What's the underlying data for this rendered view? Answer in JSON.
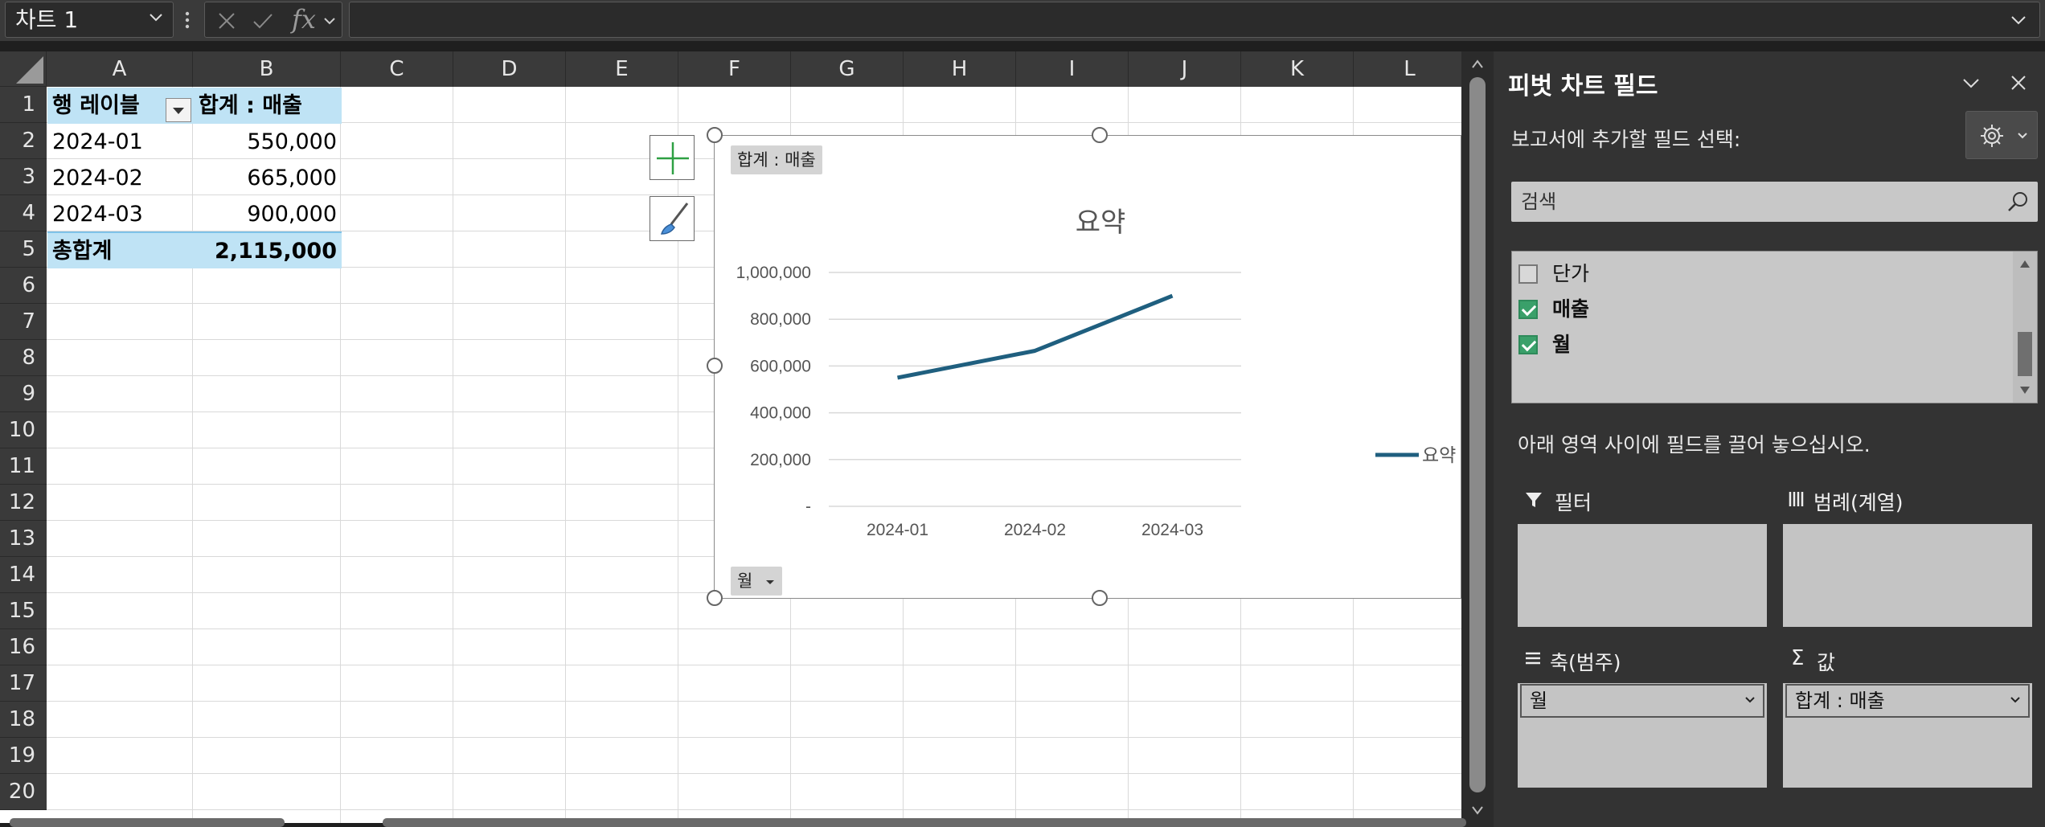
{
  "formula_bar": {
    "name_box": "차트 1",
    "fx": "fx",
    "formula": ""
  },
  "grid": {
    "columns": [
      "A",
      "B",
      "C",
      "D",
      "E",
      "F",
      "G",
      "H",
      "I",
      "J",
      "K",
      "L"
    ],
    "rows": [
      "1",
      "2",
      "3",
      "4",
      "5",
      "6",
      "7",
      "8",
      "9",
      "10",
      "11",
      "12",
      "13",
      "14",
      "15",
      "16",
      "17",
      "18",
      "19",
      "20"
    ],
    "pivot": {
      "header_row_label": "행 레이블",
      "header_value": "합계 : 매출",
      "rows": [
        {
          "label": "2024-01",
          "value": "550,000"
        },
        {
          "label": "2024-02",
          "value": "665,000"
        },
        {
          "label": "2024-03",
          "value": "900,000"
        }
      ],
      "total_label": "총합계",
      "total_value": "2,115,000"
    }
  },
  "chart": {
    "value_field_button": "합계 : 매출",
    "axis_field_button": "월",
    "legend_label": "요약",
    "series_color": "#1f5f7f",
    "y_tick_labels": [
      "1,000,000",
      "800,000",
      "600,000",
      "400,000",
      "200,000",
      "-"
    ]
  },
  "chart_data": {
    "type": "line",
    "title": "요약",
    "categories": [
      "2024-01",
      "2024-02",
      "2024-03"
    ],
    "series": [
      {
        "name": "요약",
        "values": [
          550000,
          665000,
          900000
        ]
      }
    ],
    "xlabel": "",
    "ylabel": "",
    "ylim": [
      0,
      1000000
    ],
    "grid": true,
    "legend": "right"
  },
  "pane": {
    "title": "피벗 차트 필드",
    "subtitle": "보고서에 추가할 필드 선택:",
    "search_placeholder": "검색",
    "fields": [
      {
        "label": "단가",
        "checked": false
      },
      {
        "label": "매출",
        "checked": true
      },
      {
        "label": "월",
        "checked": true
      }
    ],
    "drag_instruction": "아래 영역 사이에 필드를 끌어 놓으십시오.",
    "areas": {
      "filter": "필터",
      "legend": "범례(계열)",
      "axis": "축(범주)",
      "values": "값",
      "axis_field": "월",
      "values_field": "합계 : 매출"
    }
  }
}
